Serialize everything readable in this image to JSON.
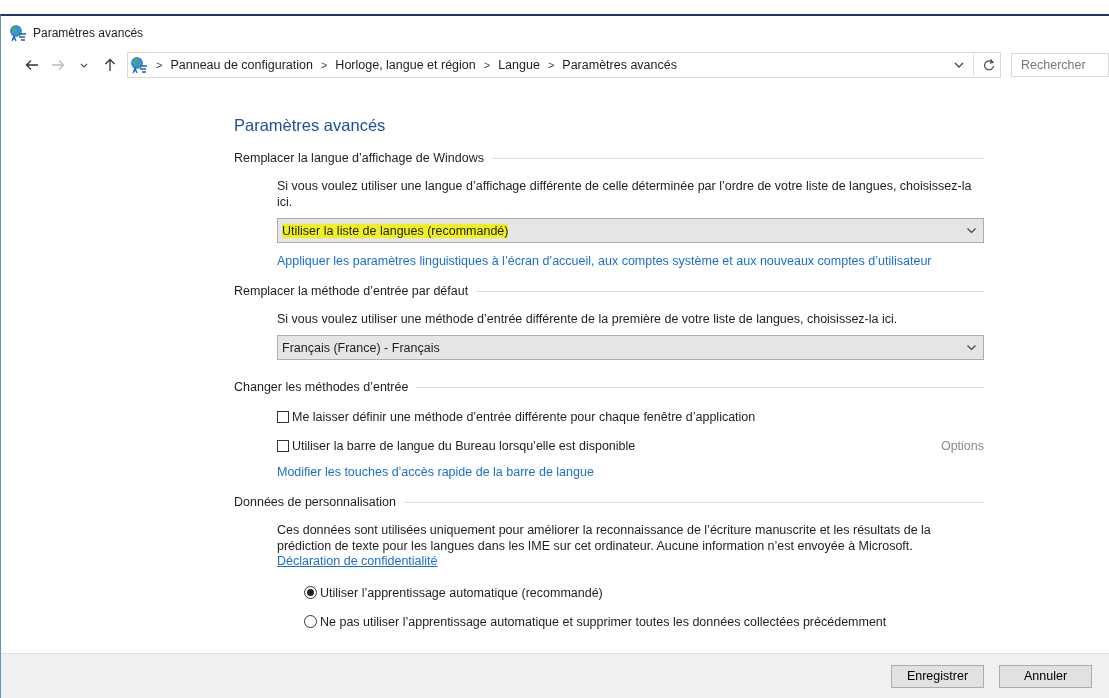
{
  "window": {
    "title": "Paramètres avancés"
  },
  "address_bar": {
    "breadcrumbs": [
      "Panneau de configuration",
      "Horloge, langue et région",
      "Langue",
      "Paramètres avancés"
    ],
    "separator": ">",
    "search": {
      "placeholder": "Rechercher"
    }
  },
  "heading": "Paramètres avancés",
  "sections": [
    {
      "title": "Remplacer la langue d’affichage de Windows",
      "items": [
        {
          "kind": "text",
          "text": "Si vous voulez utiliser une langue d’affichage différente de celle déterminée par l’ordre de votre liste de langues, choisissez-la ici."
        },
        {
          "kind": "dropdown",
          "value": "Utiliser la liste de langues (recommandé)",
          "highlighted": true
        },
        {
          "kind": "link",
          "text": "Appliquer les paramètres linguistiques à l’écran d’accueil, aux comptes système et aux nouveaux comptes d’utilisateur"
        }
      ]
    },
    {
      "title": "Remplacer la méthode d’entrée par défaut",
      "items": [
        {
          "kind": "text",
          "text": "Si vous voulez utiliser une méthode d’entrée différente de la première de votre liste de langues, choisissez-la ici."
        },
        {
          "kind": "dropdown",
          "value": "Français (France) - Français",
          "highlighted": false
        }
      ]
    },
    {
      "title": "Changer les méthodes d’entrée",
      "items": [
        {
          "kind": "checkbox",
          "label": "Me laisser définir une méthode d’entrée différente pour chaque fenêtre d’application",
          "checked": false
        },
        {
          "kind": "checkbox",
          "label": "Utiliser la barre de langue du Bureau lorsqu’elle est disponible",
          "checked": false,
          "action": {
            "label": "Options",
            "disabled": true
          }
        },
        {
          "kind": "link",
          "text": "Modifier les touches d’accès rapide de la barre de langue"
        }
      ]
    },
    {
      "title": "Données de personnalisation",
      "items": [
        {
          "kind": "text",
          "text": "Ces données sont utilisées uniquement pour améliorer la reconnaissance de l’écriture manuscrite et les résultats de la prédiction de texte pour les langues dans les IME sur cet ordinateur. Aucune information n’est envoyée à Microsoft."
        },
        {
          "kind": "underlined_link",
          "text": "Déclaration de confidentialité"
        },
        {
          "kind": "radio",
          "label": "Utiliser l’apprentissage automatique (recommandé)",
          "selected": true
        },
        {
          "kind": "radio",
          "label": "Ne pas utiliser l’apprentissage automatique et supprimer toutes les données collectées précédemment",
          "selected": false
        }
      ]
    }
  ],
  "buttons": [
    "Enregistrer",
    "Annuler"
  ]
}
